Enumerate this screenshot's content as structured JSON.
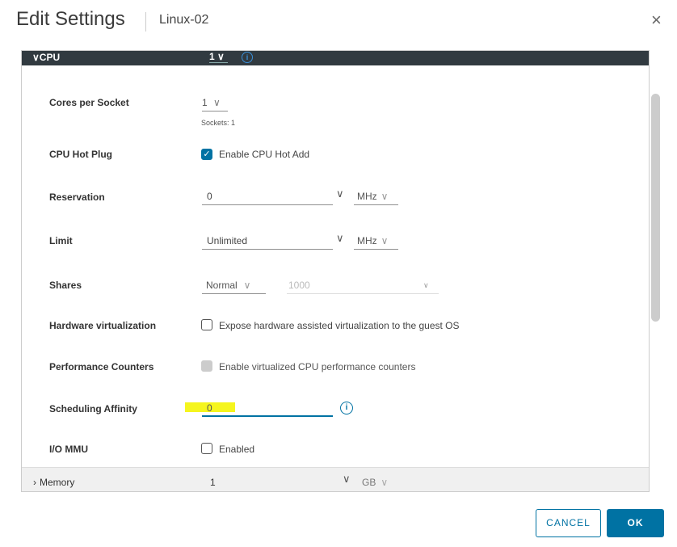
{
  "dialog": {
    "title": "Edit Settings",
    "subtitle": "Linux-02",
    "close_icon": "close-icon"
  },
  "cpu": {
    "section_label": "CPU",
    "value": "1",
    "cores_per_socket_label": "Cores per Socket",
    "cores_per_socket_value": "1",
    "sockets_text": "Sockets: 1",
    "hot_plug_label": "CPU Hot Plug",
    "hot_plug_checkbox_label": "Enable CPU Hot Add",
    "reservation_label": "Reservation",
    "reservation_value": "0",
    "reservation_unit": "MHz",
    "limit_label": "Limit",
    "limit_value": "Unlimited",
    "limit_unit": "MHz",
    "shares_label": "Shares",
    "shares_value": "Normal",
    "shares_number": "1000",
    "hw_virt_label": "Hardware virtualization",
    "hw_virt_checkbox_label": "Expose hardware assisted virtualization to the guest OS",
    "perf_counters_label": "Performance Counters",
    "perf_counters_checkbox_label": "Enable virtualized CPU performance counters",
    "affinity_label": "Scheduling Affinity",
    "affinity_value": "0",
    "iommu_label": "I/O MMU",
    "iommu_checkbox_label": "Enabled"
  },
  "memory": {
    "section_label": "Memory",
    "value": "1",
    "unit": "GB"
  },
  "buttons": {
    "cancel": "CANCEL",
    "ok": "OK"
  },
  "colors": {
    "accent": "#0072a3",
    "header_bg": "#313a40",
    "highlight": "#f5f51e"
  }
}
